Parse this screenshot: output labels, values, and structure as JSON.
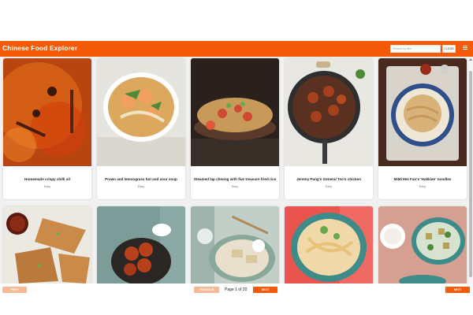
{
  "app": {
    "title": "Chinese Food Explorer"
  },
  "header": {
    "search_placeholder": "Search by title",
    "clear_label": "CLEAR"
  },
  "icons": {
    "menu": "menu-icon",
    "scroll_up": "triangle-up-icon"
  },
  "colors": {
    "brand": "#f35b09",
    "brand_faded": "#f7b893"
  },
  "recipes": [
    {
      "title": "Homemade crispy chilli oil",
      "difficulty": "Easy"
    },
    {
      "title": "Prawn and lemongrass hot and sour soup",
      "difficulty": "Easy"
    },
    {
      "title": "Steamed lap cheong with five treasure fried rice",
      "difficulty": "Easy"
    },
    {
      "title": "Jeremy Pang's General Tso's chicken",
      "difficulty": "Easy"
    },
    {
      "title": "MiMi Mei Fair's 'Hokkien' noodles",
      "difficulty": "Easy"
    }
  ],
  "pagination": {
    "prev_label": "PREV",
    "page_text": "Page 1 of 20",
    "prev2_label": "PREVIOUS",
    "next_label": "NEXT",
    "next2_label": "NEXT"
  }
}
